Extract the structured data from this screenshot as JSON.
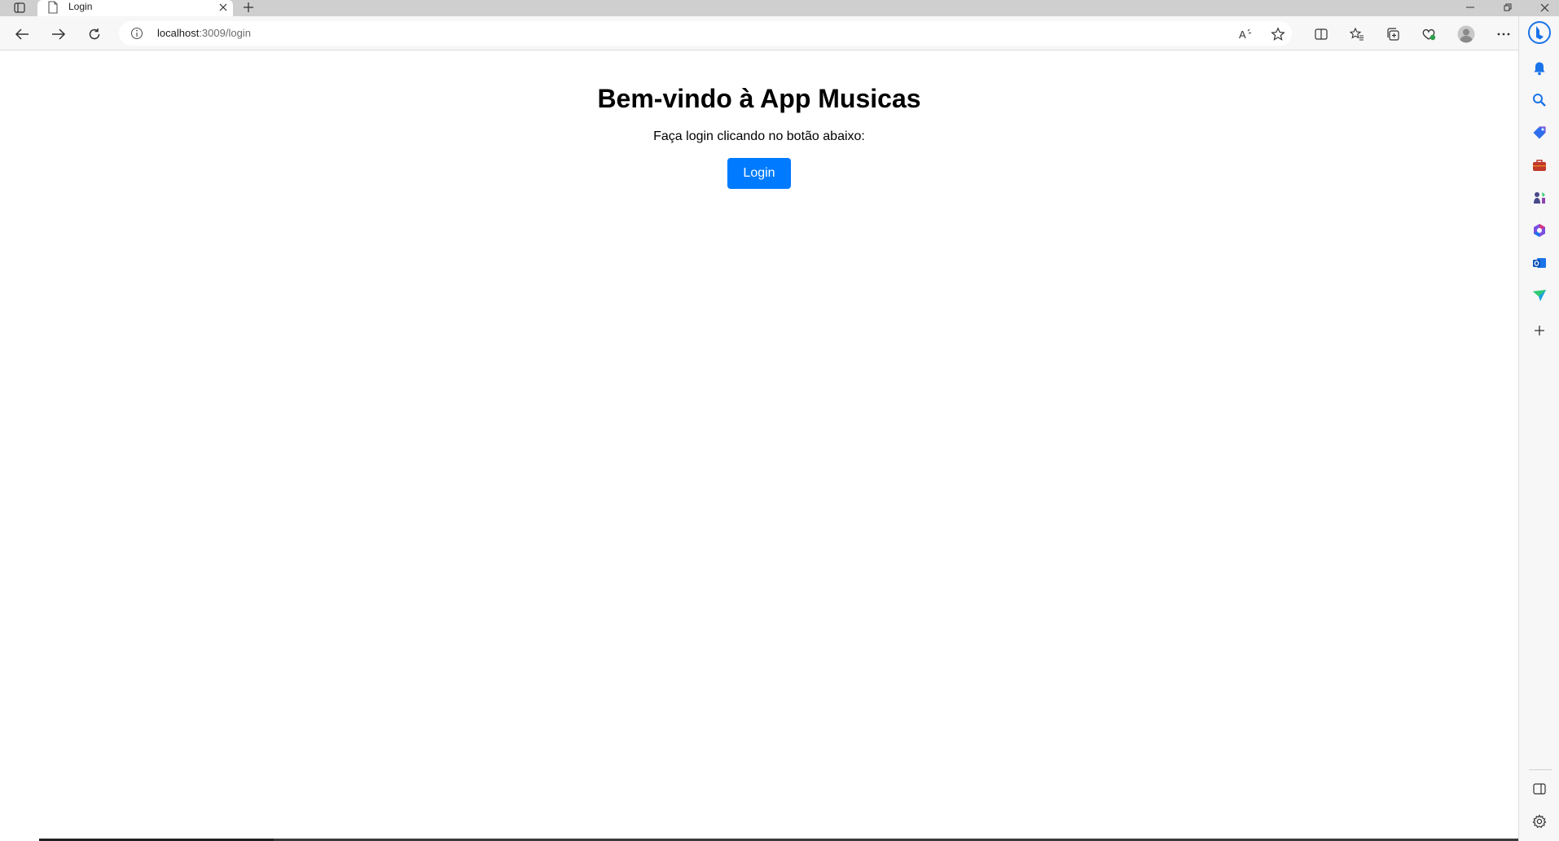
{
  "browser": {
    "tab": {
      "title": "Login",
      "page_icon": "page-icon",
      "close_icon": "close-icon"
    },
    "new_tab_icon": "plus-icon",
    "window_controls": [
      "minimize-icon",
      "restore-icon",
      "close-icon"
    ],
    "address": {
      "host": "localhost",
      "path": ":3009/login",
      "info_icon": "info-icon"
    },
    "toolbar_icons": [
      "back-icon",
      "forward-icon",
      "refresh-icon",
      "read-aloud-icon",
      "favorite-star-icon",
      "split-screen-icon",
      "favorites-icon",
      "collections-icon",
      "browser-essentials-icon",
      "profile-icon",
      "more-icon"
    ],
    "sidebar_icons": [
      "bing-copilot-icon",
      "notifications-icon",
      "search-icon",
      "shopping-icon",
      "tools-icon",
      "games-icon",
      "microsoft-365-icon",
      "outlook-icon",
      "drop-icon",
      "add-icon",
      "hide-sidebar-icon",
      "settings-icon"
    ]
  },
  "page": {
    "title": "Bem-vindo à App Musicas",
    "subtitle": "Faça login clicando no botão abaixo:",
    "login_button": "Login"
  },
  "colors": {
    "accent": "#007bff",
    "tabstrip": "#cfcfcf",
    "toolbar": "#f7f7f7"
  }
}
